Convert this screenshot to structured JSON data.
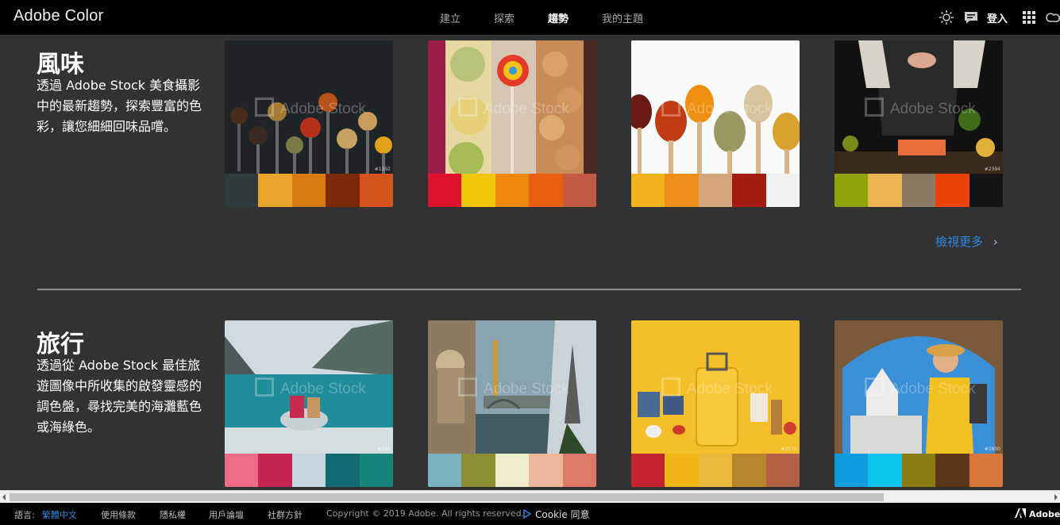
{
  "app": {
    "title": "Adobe Color"
  },
  "nav": {
    "create": "建立",
    "explore": "探索",
    "trends": "趨勢",
    "my_themes": "我的主題"
  },
  "header": {
    "signin": "登入",
    "icons": [
      "theme-toggle-icon",
      "feedback-icon",
      "apps-grid-icon",
      "creative-cloud-icon"
    ]
  },
  "sections": [
    {
      "title": "風味",
      "description": "透過 Adobe Stock 美食攝影中的最新趨勢，探索豐富的色彩，讓您細細回味品嚐。",
      "cards": [
        {
          "watermark": "Adobe Stock",
          "image_id": "#1392",
          "swatches": [
            "#2e3a3c",
            "#eba52a",
            "#d87a12",
            "#7d2a0b",
            "#d5531d"
          ]
        },
        {
          "watermark": "Adobe Stock",
          "image_id": "",
          "swatches": [
            "#e0132e",
            "#f0c70b",
            "#ef880f",
            "#ea5f10",
            "#c35a44"
          ]
        },
        {
          "watermark": "Adobe Stock",
          "image_id": "",
          "swatches": [
            "#efb41b",
            "#ee8f19",
            "#d4a47b",
            "#a21c12",
            "#f1f1f1"
          ]
        },
        {
          "watermark": "Adobe Stock",
          "image_id": "#2394",
          "swatches": [
            "#8ea408",
            "#ecb450",
            "#8c7b62",
            "#ea4208",
            "#141414"
          ]
        }
      ]
    },
    {
      "title": "旅行",
      "description": "透過從 Adobe Stock 最佳旅遊圖像中所收集的啟發靈感的調色盤，尋找完美的海灘藍色或海綠色。",
      "cards": [
        {
          "watermark": "Adobe Stock",
          "image_id": "#245",
          "swatches": [
            "#ec6c87",
            "#c52452",
            "#c4d5df",
            "#126b73",
            "#15857c"
          ]
        },
        {
          "watermark": "Adobe Stock",
          "image_id": "",
          "swatches": [
            "#7ab2c2",
            "#8d8d33",
            "#efeccc",
            "#edb899",
            "#dc7968"
          ]
        },
        {
          "watermark": "Adobe Stock",
          "image_id": "#2570",
          "swatches": [
            "#c4222f",
            "#eeb514",
            "#e9b83d",
            "#b7862a",
            "#b36046"
          ]
        },
        {
          "watermark": "Adobe Stock",
          "image_id": "#2800",
          "swatches": [
            "#0d9cdd",
            "#0bc4ee",
            "#8c7d12",
            "#5b3717",
            "#d8763c"
          ]
        }
      ]
    }
  ],
  "view_more": "檢視更多",
  "footer": {
    "language_label": "語言:",
    "language": "繁體中文",
    "terms": "使用條款",
    "privacy": "隱私權",
    "forums": "用戶論壇",
    "community": "社群方針",
    "copyright": "Copyright © 2019 Adobe. All rights reserved.",
    "cookie": "Cookie 同意",
    "adobe": "Adobe"
  },
  "colors": {
    "accent": "#2d87e2",
    "background": "#323232",
    "topbar": "#000000"
  }
}
